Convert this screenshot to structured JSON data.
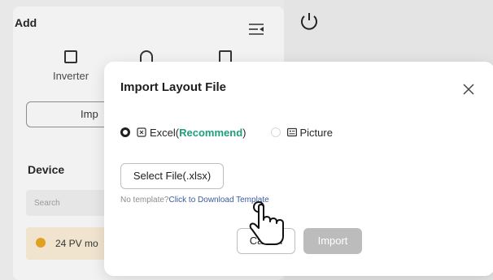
{
  "panel": {
    "title": "Add",
    "items": [
      {
        "label": "Inverter",
        "icon": "inverter-icon"
      },
      {
        "label": "",
        "icon": "meter-icon"
      },
      {
        "label": "",
        "icon": "device-icon"
      }
    ],
    "import_label": "Imp",
    "device_title": "Device",
    "search_placeholder": "Search",
    "alert_text": "24 PV mo"
  },
  "modal": {
    "title": "Import Layout File",
    "options": {
      "excel_label": "Excel(",
      "excel_recommend": "Recommend",
      "excel_close": ")",
      "picture_label": "Picture"
    },
    "select_file_label": "Select File(.xlsx)",
    "template_prefix": "No template?",
    "template_link": "Click to Download Template",
    "cancel_label": "Cancel",
    "import_label": "Import"
  },
  "colors": {
    "accent": "#1ba07a",
    "link": "#3a5a9a",
    "disabled_button": "#bcbcbc",
    "alert_dot": "#e0a020"
  }
}
